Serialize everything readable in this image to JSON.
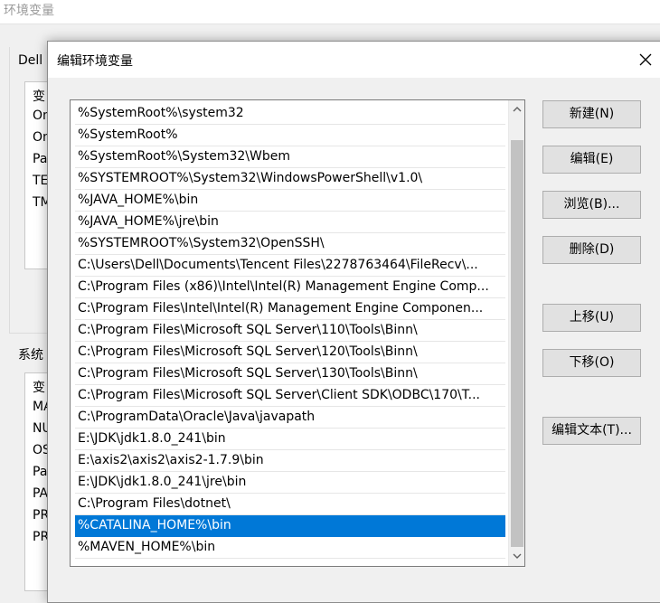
{
  "parent_window": {
    "title": "环境变量",
    "user_group_label": "Dell",
    "system_group_label": "系统",
    "user_list_fragments": [
      "变",
      "On",
      "On",
      "Pa",
      "TE",
      "TM"
    ],
    "system_list_fragments": [
      "变",
      "MA",
      "NU",
      "OS",
      "Pa",
      "PA",
      "PR",
      "PR"
    ]
  },
  "dialog": {
    "title": "编辑环境变量",
    "close_icon": "close-x-icon",
    "paths": [
      "%SystemRoot%\\system32",
      "%SystemRoot%",
      "%SystemRoot%\\System32\\Wbem",
      "%SYSTEMROOT%\\System32\\WindowsPowerShell\\v1.0\\",
      "%JAVA_HOME%\\bin",
      "%JAVA_HOME%\\jre\\bin",
      "%SYSTEMROOT%\\System32\\OpenSSH\\",
      "C:\\Users\\Dell\\Documents\\Tencent Files\\2278763464\\FileRecv\\...",
      "C:\\Program Files (x86)\\Intel\\Intel(R) Management Engine Comp...",
      "C:\\Program Files\\Intel\\Intel(R) Management Engine Componen...",
      "C:\\Program Files\\Microsoft SQL Server\\110\\Tools\\Binn\\",
      "C:\\Program Files\\Microsoft SQL Server\\120\\Tools\\Binn\\",
      "C:\\Program Files\\Microsoft SQL Server\\130\\Tools\\Binn\\",
      "C:\\Program Files\\Microsoft SQL Server\\Client SDK\\ODBC\\170\\T...",
      "C:\\ProgramData\\Oracle\\Java\\javapath",
      "E:\\JDK\\jdk1.8.0_241\\bin",
      "E:\\axis2\\axis2\\axis2-1.7.9\\bin",
      "E:\\JDK\\jdk1.8.0_241\\jre\\bin",
      "C:\\Program Files\\dotnet\\",
      "%CATALINA_HOME%\\bin",
      "%MAVEN_HOME%\\bin"
    ],
    "selected_index": 19,
    "buttons": {
      "new": "新建(N)",
      "edit": "编辑(E)",
      "browse": "浏览(B)...",
      "delete": "删除(D)",
      "move_up": "上移(U)",
      "move_down": "下移(O)",
      "edit_text": "编辑文本(T)..."
    },
    "colors": {
      "selection": "#0078d7",
      "selection_text": "#ffffff"
    }
  }
}
